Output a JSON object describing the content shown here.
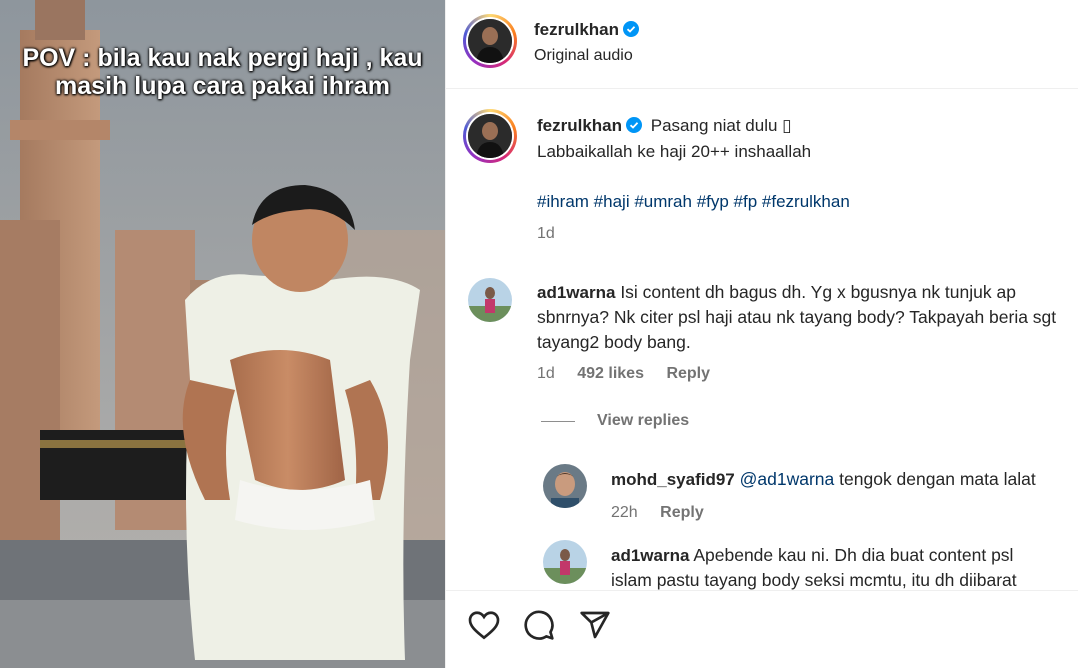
{
  "media": {
    "overlay_text": "POV : bila kau nak pergi haji , kau masih lupa cara pakai ihram"
  },
  "header": {
    "username": "fezrulkhan",
    "subtitle": "Original audio"
  },
  "caption": {
    "username": "fezrulkhan",
    "line1": "Pasang niat dulu ▯",
    "line2": "Labbaikallah ke haji 20++ inshaallah",
    "hashtags": "#ihram #haji #umrah #fyp #fp #fezrulkhan",
    "time": "1d"
  },
  "comments": [
    {
      "username": "ad1warna",
      "text": "Isi content dh bagus dh. Yg x bgusnya nk tunjuk ap sbnrnya? Nk citer psl haji atau nk tayang body? Takpayah beria sgt tayang2 body bang.",
      "time": "1d",
      "likes": "492 likes",
      "reply": "Reply",
      "view_replies": "View replies"
    }
  ],
  "replies": [
    {
      "username": "mohd_syafid97",
      "mention": "@ad1warna",
      "text": "tengok dengan mata lalat",
      "time": "22h",
      "reply": "Reply"
    },
    {
      "username": "ad1warna",
      "text_line1": "Apebende kau ni. Dh dia buat content psl",
      "text_line2": "islam pastu tayang body seksi mcmtu, itu dh diibarat"
    }
  ],
  "icons": [
    "heart-icon",
    "comment-icon",
    "share-icon",
    "verified-badge-icon"
  ],
  "colors": {
    "verified": "#0095f6",
    "hashtag": "#00376b",
    "muted": "#737373"
  }
}
